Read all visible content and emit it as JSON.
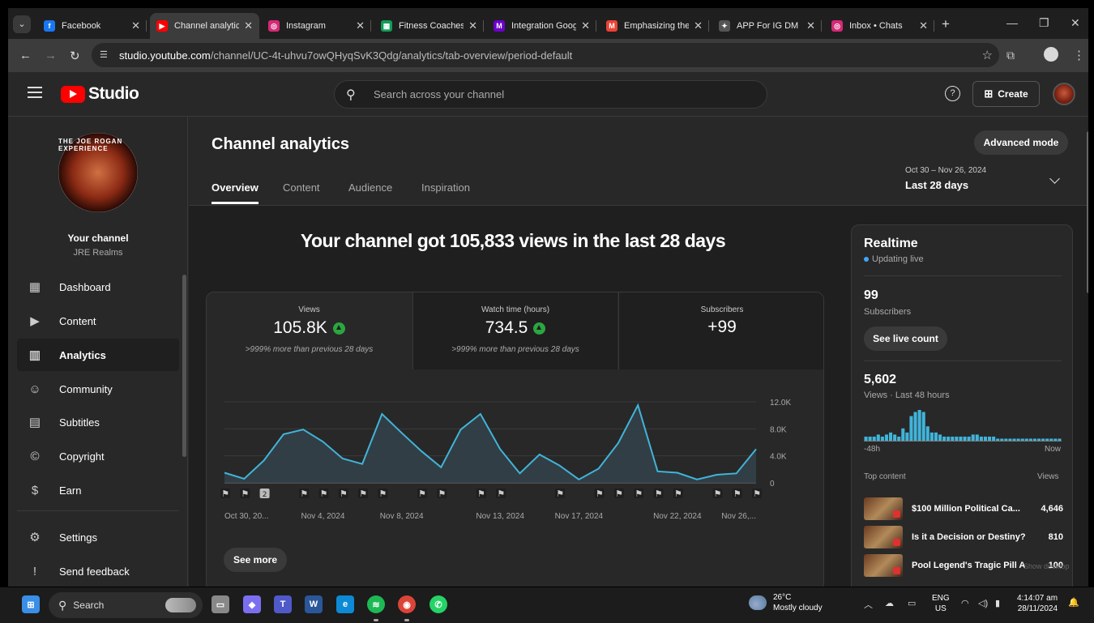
{
  "browser": {
    "tabs": [
      {
        "title": "Facebook",
        "icon": "facebook-icon",
        "color": "#1877f2",
        "glyph": "f",
        "active": false
      },
      {
        "title": "Channel analytic",
        "icon": "youtube-icon",
        "color": "#ff0000",
        "glyph": "▶",
        "active": true
      },
      {
        "title": "Instagram",
        "icon": "instagram-icon",
        "color": "#d62976",
        "glyph": "◎",
        "active": false
      },
      {
        "title": "Fitness Coaches",
        "icon": "google-sheets-icon",
        "color": "#0f9d58",
        "glyph": "▦",
        "active": false
      },
      {
        "title": "Integration Goog",
        "icon": "make-icon",
        "color": "#6d00cc",
        "glyph": "M",
        "active": false
      },
      {
        "title": "Emphasizing the",
        "icon": "gmail-icon",
        "color": "#ea4335",
        "glyph": "M",
        "active": false
      },
      {
        "title": "APP For IG DM",
        "icon": "chatgpt-icon",
        "color": "#555555",
        "glyph": "✦",
        "active": false
      },
      {
        "title": "Inbox • Chats",
        "icon": "instagram-icon",
        "color": "#d62976",
        "glyph": "◎",
        "active": false
      }
    ],
    "url_host": "studio.youtube.com",
    "url_path": "/channel/UC-4t-uhvu7owQHyqSvK3Qdg/analytics/tab-overview/period-default"
  },
  "studio": {
    "logo_text": "Studio",
    "search_placeholder": "Search across your channel",
    "create_label": "Create"
  },
  "sidebar": {
    "your_channel": "Your channel",
    "channel_name": "JRE Realms",
    "avatar_text": "THE JOE ROGAN EXPERIENCE",
    "items": [
      {
        "label": "Dashboard",
        "icon": "dashboard-icon",
        "glyph": "▦"
      },
      {
        "label": "Content",
        "icon": "content-icon",
        "glyph": "▶"
      },
      {
        "label": "Analytics",
        "icon": "analytics-icon",
        "glyph": "▥"
      },
      {
        "label": "Community",
        "icon": "community-icon",
        "glyph": "☺"
      },
      {
        "label": "Subtitles",
        "icon": "subtitles-icon",
        "glyph": "▤"
      },
      {
        "label": "Copyright",
        "icon": "copyright-icon",
        "glyph": "©"
      },
      {
        "label": "Earn",
        "icon": "earn-icon",
        "glyph": "$"
      },
      {
        "label": "Settings",
        "icon": "settings-icon",
        "glyph": "⚙"
      },
      {
        "label": "Send feedback",
        "icon": "feedback-icon",
        "glyph": "!"
      }
    ],
    "active_item": "Analytics"
  },
  "main": {
    "title": "Channel analytics",
    "tabs": [
      "Overview",
      "Content",
      "Audience",
      "Inspiration"
    ],
    "active_tab": "Overview",
    "advanced_mode": "Advanced mode",
    "date_range": "Oct 30 – Nov 26, 2024",
    "date_period": "Last 28 days",
    "headline": "Your channel got 105,833 views in the last 28 days",
    "metrics": [
      {
        "label": "Views",
        "value": "105.8K",
        "sub": ">999% more than previous 28 days",
        "trend": "up"
      },
      {
        "label": "Watch time (hours)",
        "value": "734.5",
        "sub": ">999% more than previous 28 days",
        "trend": "up"
      },
      {
        "label": "Subscribers",
        "value": "+99",
        "sub": "",
        "trend": ""
      }
    ],
    "see_more": "See more"
  },
  "chart_data": [
    {
      "type": "area",
      "x": [
        "Oct 30",
        "Oct 31",
        "Nov 1",
        "Nov 2",
        "Nov 3",
        "Nov 4",
        "Nov 5",
        "Nov 6",
        "Nov 7",
        "Nov 8",
        "Nov 9",
        "Nov 10",
        "Nov 11",
        "Nov 12",
        "Nov 13",
        "Nov 14",
        "Nov 15",
        "Nov 16",
        "Nov 17",
        "Nov 18",
        "Nov 19",
        "Nov 20",
        "Nov 21",
        "Nov 22",
        "Nov 23",
        "Nov 24",
        "Nov 25",
        "Nov 26"
      ],
      "x_tick_labels": [
        "Oct 30, 20...",
        "Nov 4, 2024",
        "Nov 8, 2024",
        "Nov 13, 2024",
        "Nov 17, 2024",
        "Nov 22, 2024",
        "Nov 26,..."
      ],
      "series": [
        {
          "values": [
            1500,
            600,
            3300,
            7200,
            7900,
            6100,
            3600,
            2800,
            10200,
            7400,
            4700,
            2300,
            7900,
            10200,
            5000,
            1400,
            4200,
            2600,
            500,
            2100,
            5900,
            11500,
            1700,
            1500,
            500,
            1200,
            1400,
            5000
          ]
        }
      ],
      "y_ticks": [
        "0",
        "4.0K",
        "8.0K",
        "12.0K"
      ],
      "ylim": [
        0,
        12000
      ],
      "color": "#41b4d9",
      "upload_markers": [
        1,
        1,
        2,
        0,
        1,
        1,
        1,
        1,
        1,
        0,
        1,
        1,
        0,
        1,
        1,
        0,
        0,
        1,
        0,
        1,
        1,
        1,
        1,
        1,
        0,
        1,
        1,
        1
      ],
      "grid": true
    },
    {
      "type": "bar",
      "values": [
        2,
        2,
        2,
        3,
        2,
        3,
        4,
        3,
        2,
        6,
        4,
        12,
        14,
        15,
        14,
        7,
        4,
        4,
        3,
        2,
        2,
        2,
        2,
        2,
        2,
        2,
        3,
        3,
        2,
        2,
        2,
        2,
        1,
        1,
        1,
        1,
        1,
        1,
        1,
        1,
        1,
        1,
        1,
        1,
        1,
        1,
        1,
        1
      ],
      "color": "#41b4d9",
      "x_left_label": "-48h",
      "x_right_label": "Now"
    }
  ],
  "realtime": {
    "title": "Realtime",
    "live_label": "Updating live",
    "subscribers_value": "99",
    "subscribers_label": "Subscribers",
    "see_live_count": "See live count",
    "views_value": "5,602",
    "views_label": "Views · Last 48 hours",
    "top_content_header": "Top content",
    "views_header": "Views",
    "top_content": [
      {
        "title": "$100 Million Political Ca...",
        "views": "4,646"
      },
      {
        "title": "Is it a Decision or Destiny? ...",
        "views": "810"
      },
      {
        "title": "Pool Legend's Tragic Pill A...",
        "views": "100"
      }
    ]
  },
  "desktop": {
    "show_desktop": "Show desktop",
    "taskbar_search": "Search",
    "weather_temp": "26°C",
    "weather_desc": "Mostly cloudy",
    "lang_1": "ENG",
    "lang_2": "US",
    "time": "4:14:07 am",
    "date": "28/11/2024",
    "apps": [
      {
        "icon": "windows-start-icon",
        "color": "#3a8ee6",
        "glyph": "⊞"
      },
      {
        "icon": "file-explorer-icon",
        "color": "#888888",
        "glyph": "▭"
      },
      {
        "icon": "copilot-icon",
        "color": "#7b6ff0",
        "glyph": "◆"
      },
      {
        "icon": "teams-icon",
        "color": "#5059c9",
        "glyph": "T"
      },
      {
        "icon": "word-icon",
        "color": "#2b579a",
        "glyph": "W"
      },
      {
        "icon": "edge-icon",
        "color": "#0c8ad6",
        "glyph": "e"
      },
      {
        "icon": "spotify-icon",
        "color": "#1db954",
        "glyph": "≋"
      },
      {
        "icon": "chrome-icon",
        "color": "#db4437",
        "glyph": "◉"
      },
      {
        "icon": "whatsapp-icon",
        "color": "#25d366",
        "glyph": "✆"
      }
    ]
  }
}
